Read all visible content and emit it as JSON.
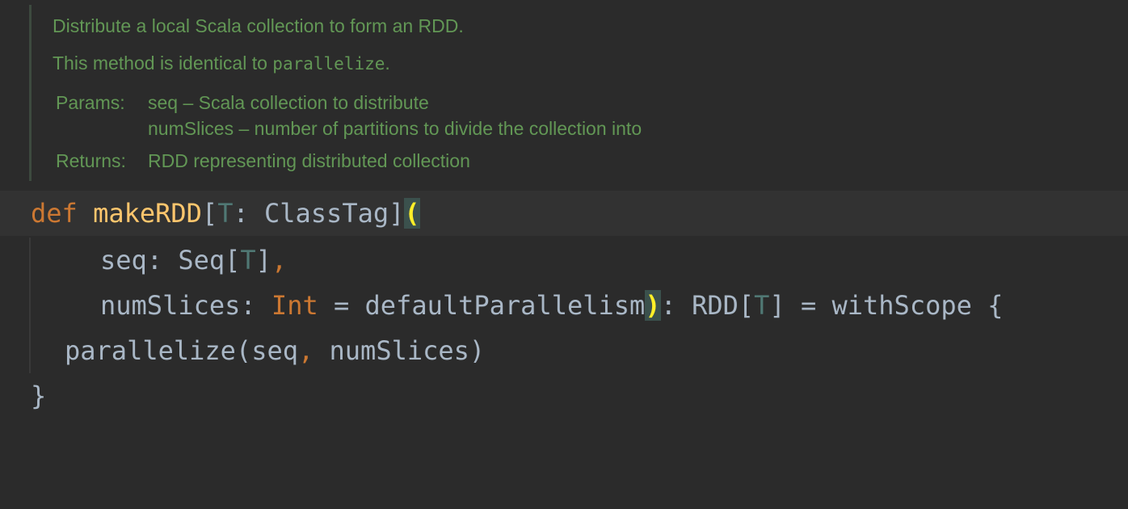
{
  "doc": {
    "summary": "Distribute a local Scala collection to form an RDD.",
    "identical_prefix": "This method is identical to ",
    "identical_code": "parallelize",
    "identical_suffix": ".",
    "params_label": "Params:",
    "params": [
      "seq – Scala collection to distribute",
      "numSlices – number of partitions to divide the collection into"
    ],
    "returns_label": "Returns:",
    "returns_value": "RDD representing distributed collection"
  },
  "code": {
    "line1": {
      "kw_def": "def",
      "space1": " ",
      "fn_name": "makeRDD",
      "bracket_open": "[",
      "type_param": "T",
      "colon_classtag": ": ClassTag]",
      "paren_open": "("
    },
    "line2": {
      "seq_decl": "seq: Seq[",
      "type_param": "T",
      "close": "]",
      "comma": ","
    },
    "line3": {
      "numslices": "numSlices: ",
      "int_type": "Int",
      "default": " = defaultParallelism",
      "paren_close": ")",
      "ret_prefix": ": RDD[",
      "type_param": "T",
      "ret_suffix": "] = withScope {"
    },
    "line4": {
      "call_start": "parallelize(seq",
      "comma": ",",
      "call_end": " numSlices)"
    },
    "line5": {
      "brace": "}"
    }
  },
  "colors": {
    "background": "#2b2b2b",
    "doc_text": "#629755",
    "keyword": "#cc7832",
    "function": "#ffc66d",
    "type_param": "#507874",
    "identifier": "#a9b7c6",
    "paren_match": "#ffef28"
  }
}
